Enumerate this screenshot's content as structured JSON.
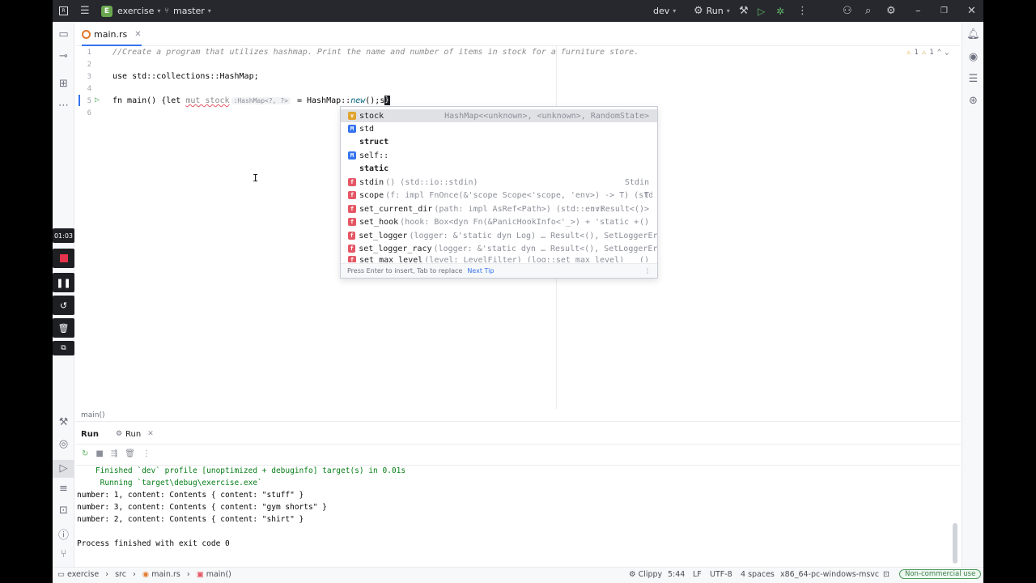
{
  "titlebar": {
    "project_initial": "E",
    "project": "exercise",
    "branch": "master",
    "config": "dev",
    "run_label": "Run"
  },
  "tab": {
    "file": "main.rs"
  },
  "editor": {
    "line_numbers": [
      "1",
      "2",
      "3",
      "4",
      "5",
      "6"
    ],
    "line1": "//Create a program that utilizes hashmap. Print the name and number of items in stock for a furniture store.",
    "line3": "use std::collections::HashMap;",
    "l5_fn": "fn main() {",
    "l5_let": "let ",
    "l5_mut_stock": "mut stock",
    "l5_hint": ":HashMap<?, ?>",
    "l5_eq": " = HashMap::",
    "l5_new": "new",
    "l5_end": "();s",
    "l5_caret": "}",
    "warnings": "1",
    "weak_warnings": "1"
  },
  "completion": {
    "items": [
      {
        "name": "stock",
        "tail": "",
        "type": "HashMap<<unknown>, <unknown>, RandomState>"
      },
      {
        "name": "std",
        "tail": "",
        "type": ""
      },
      {
        "name": "struct",
        "tail": "",
        "type": ""
      },
      {
        "name": "self::",
        "tail": "",
        "type": ""
      },
      {
        "name": "static",
        "tail": "",
        "type": ""
      },
      {
        "name": "stdin",
        "tail": "() (std::io::stdin)",
        "type": "Stdin"
      },
      {
        "name": "scope",
        "tail": "(f: impl FnOnce(&'scope Scope<'scope, 'env>) -> T) (std::…",
        "type": "T"
      },
      {
        "name": "set_current_dir",
        "tail": "(path: impl AsRef<Path>) (std::env::…",
        "type": "::Result<()>"
      },
      {
        "name": "set_hook",
        "tail": "(hook: Box<dyn Fn(&PanicHookInfo<'_>) + 'static + Syn…",
        "type": "()"
      },
      {
        "name": "set_logger",
        "tail": "(logger: &'static dyn Log) … Result<(), SetLoggerError>",
        "type": ""
      },
      {
        "name": "set_logger_racy",
        "tail": "(logger: &'static dyn … Result<(), SetLoggerError>",
        "type": ""
      },
      {
        "name": "set_max_level",
        "tail": "(level: LevelFilter) (log::set_max_level)",
        "type": "()"
      }
    ],
    "footer": "Press Enter to insert, Tab to replace",
    "next_tip": "Next Tip"
  },
  "breadcrumb": "main()",
  "run": {
    "tab1": "Run",
    "tab2": "Run",
    "lines": [
      "    Finished `dev` profile [unoptimized + debuginfo] target(s) in 0.01s",
      "     Running `target\\debug\\exercise.exe`",
      "number: 1, content: Contents { content: \"stuff\" }",
      "number: 3, content: Contents { content: \"gym shorts\" }",
      "number: 2, content: Contents { content: \"shirt\" }",
      "",
      "Process finished with exit code 0"
    ]
  },
  "status": {
    "path1": "exercise",
    "path2": "src",
    "path3": "main.rs",
    "path4": "main()",
    "clippy": "Clippy",
    "position": "5:44",
    "line_sep": "LF",
    "encoding": "UTF-8",
    "indent": "4 spaces",
    "target": "x86_64-pc-windows-msvc",
    "license": "Non-commercial use"
  },
  "recorder": {
    "time": "01:03"
  }
}
